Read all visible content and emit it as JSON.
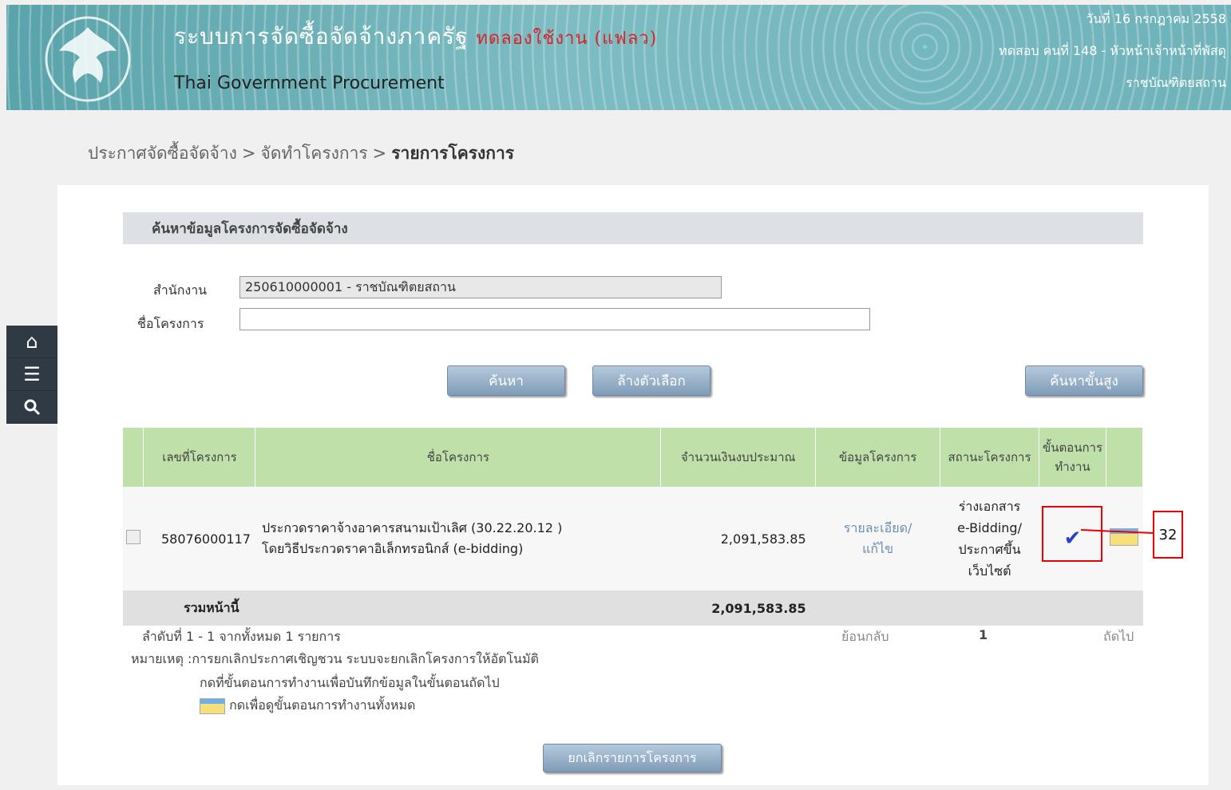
{
  "header": {
    "title_th": "ระบบการจัดซื้อจัดจ้างภาครัฐ",
    "title_tag": "ทดลองใช้งาน (แฟลว)",
    "title_en": "Thai Government Procurement",
    "date": "วันที่ 16 กรกฎาคม 2558",
    "user": "ทดสอบ คนที่ 148 - หัวหน้าเจ้าหน้าที่พัสดุ",
    "org": "ราชบัณฑิตยสถาน"
  },
  "breadcrumb": {
    "part1": "ประกาศจัดซื้อจัดจ้าง",
    "part2": "จัดทำโครงการ",
    "part3": "รายการโครงการ",
    "sep": ">"
  },
  "search": {
    "section_title": "ค้นหาข้อมูลโครงการจัดซื้อจัดจ้าง",
    "office_label": "สำนักงาน",
    "office_value": "250610000001 - ราชบัณฑิตยสถาน",
    "project_label": "ชื่อโครงการ",
    "project_value": "",
    "search_btn": "ค้นหา",
    "clear_btn": "ล้างตัวเลือก",
    "advanced_btn": "ค้นหาขั้นสูง"
  },
  "table": {
    "headers": [
      "เลขที่โครงการ",
      "ชื่อโครงการ",
      "จำนวนเงินงบประมาณ",
      "ข้อมูลโครงการ",
      "สถานะโครงการ",
      "ขั้นตอนการทำงาน"
    ],
    "row": {
      "id": "58076000117",
      "name1": "ประกวดราคาจ้างอาคารสนามเป้าเลิศ (30.22.20.12 )",
      "name2": "โดยวิธีประกวดราคาอิเล็กทรอนิกส์ (e-bidding)",
      "amount": "2,091,583.85",
      "info1": "รายละเอียด/",
      "info2": "แก้ไข",
      "status1": "ร่างเอกสาร",
      "status2": "e-Bidding/",
      "status3": "ประกาศขึ้น",
      "status4": "เว็บไซต์"
    },
    "total_label": "รวมหน้านี้",
    "total_amount": "2,091,583.85"
  },
  "footer": {
    "range": "ลำดับที่ 1 - 1 จากทั้งหมด 1 รายการ",
    "prev": "ย้อนกลับ",
    "page": "1",
    "next": "ถัดไป",
    "note1": "หมายเหตุ :การยกเลิกประกาศเชิญชวน ระบบจะยกเลิกโครงการให้อัตโนมัติ",
    "note2": "กดที่ขั้นตอนการทำงานเพื่อบันทึกข้อมูลในขั้นตอนถัดไป",
    "note3": "กดเพื่อดูขั้นตอนการทำงานทั้งหมด",
    "cancel_btn": "ยกเลิกรายการโครงการ"
  },
  "callout": "32",
  "icons": {
    "home": "home-icon",
    "menu": "menu-icon",
    "search": "search-icon",
    "step": "checkmark-icon",
    "all_steps": "steps-bar-icon"
  }
}
